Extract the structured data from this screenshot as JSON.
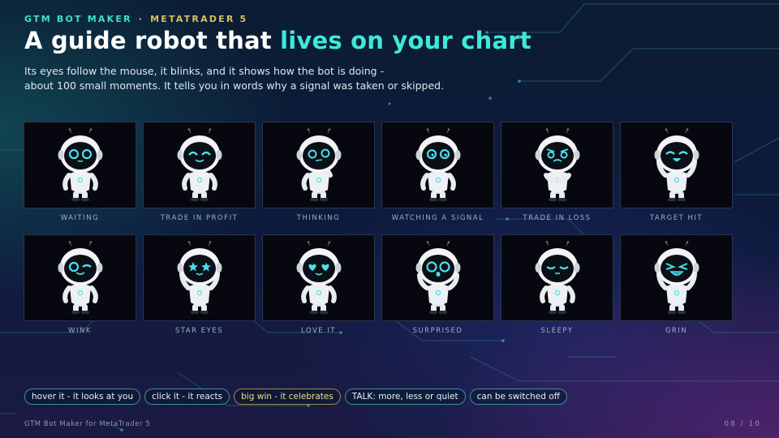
{
  "header": {
    "kicker_brand": "GTM BOT MAKER",
    "kicker_sep": "·",
    "kicker_platform": "METATRADER 5",
    "title_plain": "A guide robot that ",
    "title_accent": "lives on your chart",
    "subtitle_line1": "Its eyes follow the mouse, it blinks, and it shows how the bot is doing -",
    "subtitle_line2": "about 100 small moments. It tells you in words why a signal was taken or skipped."
  },
  "moods": [
    {
      "label": "WAITING",
      "face": "neutral-eyes",
      "pose": "standing"
    },
    {
      "label": "TRADE IN PROFIT",
      "face": "happy-eyes",
      "pose": "standing"
    },
    {
      "label": "THINKING",
      "face": "thinking-eyes",
      "pose": "hand-on-chin"
    },
    {
      "label": "WATCHING A SIGNAL",
      "face": "focused-eyes",
      "pose": "standing"
    },
    {
      "label": "TRADE IN LOSS",
      "face": "worried-eyes",
      "pose": "hands-together"
    },
    {
      "label": "TARGET HIT",
      "face": "closed-happy-eyes",
      "pose": "hands-on-head"
    },
    {
      "label": "WINK",
      "face": "wink-eyes",
      "pose": "standing"
    },
    {
      "label": "STAR EYES",
      "face": "star-eyes",
      "pose": "hands-on-head"
    },
    {
      "label": "LOVE IT",
      "face": "heart-eyes",
      "pose": "standing"
    },
    {
      "label": "SURPRISED",
      "face": "surprised-eyes",
      "pose": "hands-up"
    },
    {
      "label": "SLEEPY",
      "face": "sleepy-eyes",
      "pose": "standing"
    },
    {
      "label": "GRIN",
      "face": "grin-eyes",
      "pose": "hands-on-head"
    }
  ],
  "chips": [
    {
      "label": "hover it - it looks at you",
      "style": "teal"
    },
    {
      "label": "click it - it reacts",
      "style": "teal"
    },
    {
      "label": "big win - it celebrates",
      "style": "gold"
    },
    {
      "label": "TALK: more, less or quiet",
      "style": "teal"
    },
    {
      "label": "can be switched off",
      "style": "teal"
    }
  ],
  "footer": {
    "left": "GTM Bot Maker for MetaTrader 5",
    "page": "08 / 10"
  },
  "colors": {
    "accent": "#3fe8d8",
    "gold": "#d8c060",
    "tile": "#07080f",
    "robot_glow": "#46e0f0"
  }
}
